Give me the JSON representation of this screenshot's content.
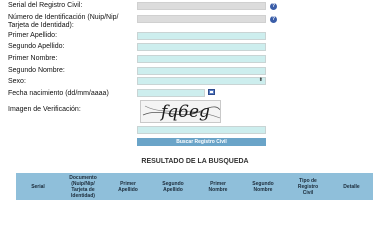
{
  "form": {
    "serial_label": "Serial del Registro Civil:",
    "id_number_label_line1": "Número de Identificación (Nuip/Nip/",
    "id_number_label_line2": "Tarjeta de Identidad):",
    "first_surname_label": "Primer Apellido:",
    "second_surname_label": "Segundo Apellido:",
    "first_name_label": "Primer Nombre:",
    "second_name_label": "Segundo Nombre:",
    "sex_label": "Sexo:",
    "birth_date_label": "Fecha nacimiento (dd/mm/aaaa)",
    "captcha_label": "Imagen de Verificación:",
    "help_symbol": "?",
    "select_arrow": "⬍"
  },
  "captcha": {
    "text": "fq6eg"
  },
  "search_button": "Buscar Registro Civil",
  "results": {
    "title": "RESULTADO DE LA BUSQUEDA",
    "columns": [
      "Serial",
      "Documento\n(Nuip/Nip/\nTarjeta de\nIdentidad)",
      "Primer\nApellido",
      "Segundo\nApellido",
      "Primer\nNombre",
      "Segundo\nNombre",
      "Tipo de\nRegistro\nCivil",
      "Detalle"
    ]
  },
  "colors": {
    "field_bg": "#cdeeee",
    "field_disabled_bg": "#dcdcdc",
    "button_bg": "#6aa4c8",
    "table_header_bg": "#8fbfda",
    "help_icon": "#3a5da8"
  }
}
